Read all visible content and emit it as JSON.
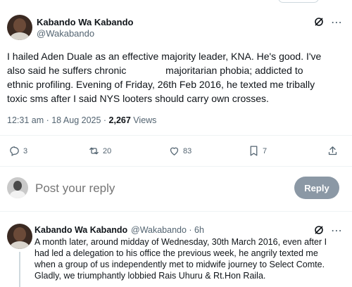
{
  "tweet": {
    "author_name": "Kabando Wa Kabando",
    "author_handle": "@Wakabando",
    "text_lines": [
      "I hailed Aden Duale as an effective majority leader, KNA. He's good.  I've",
      "also said he suffers chronic",
      "majoritarian phobia; addicted to",
      "ethnic profiling. Evening of Friday, 26th Feb 2016, he texted me tribally",
      "toxic sms after I said NYS looters should carry own crosses."
    ],
    "timestamp": "12:31 am · 18 Aug 2025 · ",
    "views_count": "2,267",
    "views_label": " Views",
    "actions": {
      "replies": "3",
      "reposts": "20",
      "likes": "83",
      "bookmarks": "7"
    }
  },
  "reply_composer": {
    "placeholder": "Post your reply",
    "button_label": "Reply"
  },
  "reply": {
    "author_name": "Kabando Wa Kabando",
    "author_handle": "@Wakabando · 6h",
    "text_lines": [
      "A month later, around midday of Wednesday, 30th March 2016, even after I",
      "had led a delegation to his office the previous week, he angrily texted me",
      "when a group of us independently met to midwife journey to Select Comte.",
      "Gladly, we triumphantly lobbied Rais Uhuru & Rt.Hon Raila."
    ]
  },
  "icons": [
    "grok-icon",
    "more-icon",
    "reply-icon",
    "repost-icon",
    "like-icon",
    "bookmark-icon",
    "share-icon"
  ],
  "colors": {
    "secondary_text": "#536471",
    "reply_button": "#8b98a5",
    "divider": "#eff3f4"
  }
}
